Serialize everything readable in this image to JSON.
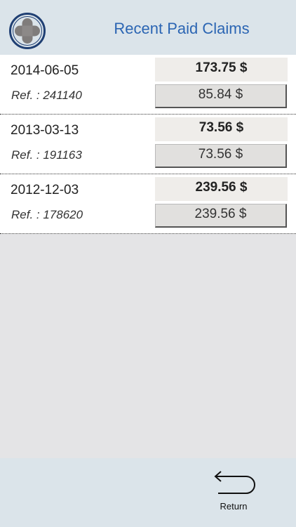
{
  "header": {
    "title": "Recent Paid Claims",
    "logo_icon": "medical-cross-icon"
  },
  "claims": [
    {
      "date": "2014-06-05",
      "ref": "Ref. : 241140",
      "total": "173.75 $",
      "paid": "85.84 $"
    },
    {
      "date": "2013-03-13",
      "ref": "Ref. : 191163",
      "total": "73.56 $",
      "paid": "73.56 $"
    },
    {
      "date": "2012-12-03",
      "ref": "Ref. : 178620",
      "total": "239.56 $",
      "paid": "239.56 $"
    }
  ],
  "footer": {
    "return_label": "Return",
    "return_icon": "return-arrow-icon"
  },
  "colors": {
    "title": "#2b65b3",
    "header_bg": "#dbe4ea",
    "logo_ring": "#1f3f73"
  }
}
